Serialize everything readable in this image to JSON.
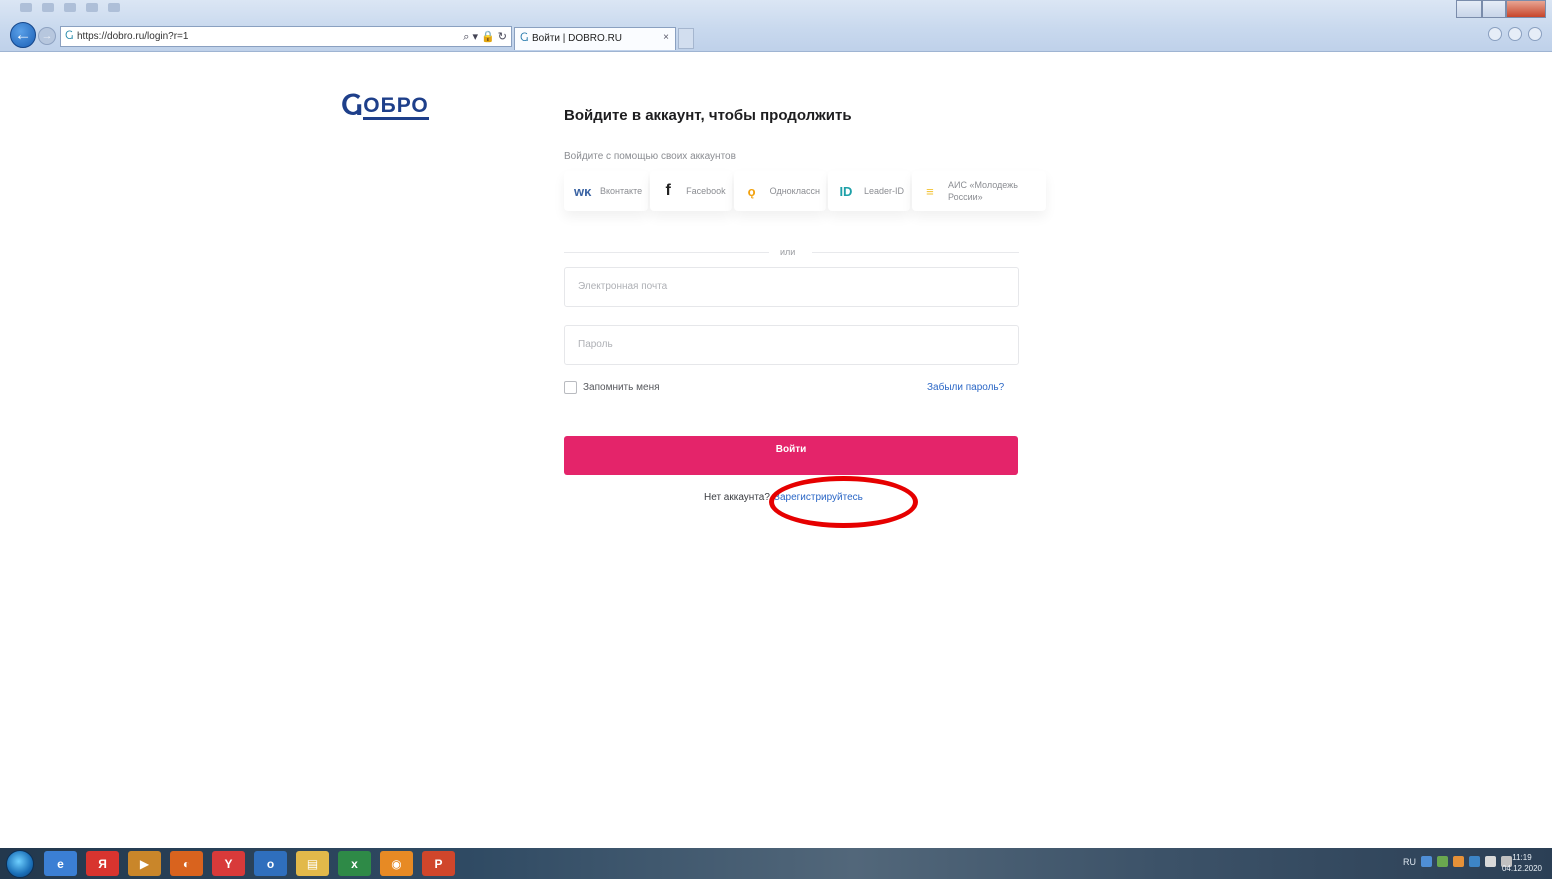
{
  "browser": {
    "address": "https://dobro.ru/login?r=1",
    "tab_title": "Войти | DOBRO.RU",
    "tab_close": "×",
    "back_icon": "←",
    "forward_icon": "→",
    "address_tools": "⌕ ▾ 🔒 ↻"
  },
  "logo": {
    "mark": "Ⴚ",
    "text": "ОБРО"
  },
  "login": {
    "heading": "Войдите в аккаунт, чтобы продолжить",
    "subheading": "Войдите с помощью своих аккаунтов",
    "socials": [
      {
        "icon": "vk-icon",
        "glyph": "ᴡᴋ",
        "label": "Вконтакте"
      },
      {
        "icon": "facebook-icon",
        "glyph": "f",
        "label": "Facebook"
      },
      {
        "icon": "odnoklassniki-icon",
        "glyph": "ǫ",
        "label": "Одноклассн"
      },
      {
        "icon": "leader-id-icon",
        "glyph": "ID",
        "label": "Leader-ID"
      },
      {
        "icon": "ais-icon",
        "glyph": "≡",
        "label": "АИС «Молодежь России»"
      }
    ],
    "divider": "или",
    "email_placeholder": "Электронная почта",
    "password_placeholder": "Пароль",
    "remember_label": "Запомнить меня",
    "forgot_label": "Забыли пароль?",
    "submit_label": "Войти",
    "no_account": "Нет аккаунта?",
    "register_label": "Зарегистрируйтесь"
  },
  "taskbar": {
    "apps": [
      {
        "name": "ie",
        "glyph": "e",
        "color": "#3b7fd4"
      },
      {
        "name": "yandex",
        "glyph": "Я",
        "color": "#d8342f"
      },
      {
        "name": "media",
        "glyph": "▶",
        "color": "#c9862a"
      },
      {
        "name": "firefox",
        "glyph": "◐",
        "color": "#d9631e"
      },
      {
        "name": "yandex-browser",
        "glyph": "Y",
        "color": "#d83a3a"
      },
      {
        "name": "outlook",
        "glyph": "o",
        "color": "#2f6fbd"
      },
      {
        "name": "explorer",
        "glyph": "▤",
        "color": "#e2b94a"
      },
      {
        "name": "excel",
        "glyph": "x",
        "color": "#2e8a47"
      },
      {
        "name": "app-orange",
        "glyph": "◉",
        "color": "#e78a24"
      },
      {
        "name": "powerpoint",
        "glyph": "P",
        "color": "#d0462b"
      }
    ],
    "lang": "RU",
    "time": "11:19",
    "date": "04.12.2020"
  },
  "colors": {
    "accent": "#e4246a",
    "link": "#2b67c6",
    "brand": "#1e3f8a",
    "annotation": "#e60000"
  }
}
